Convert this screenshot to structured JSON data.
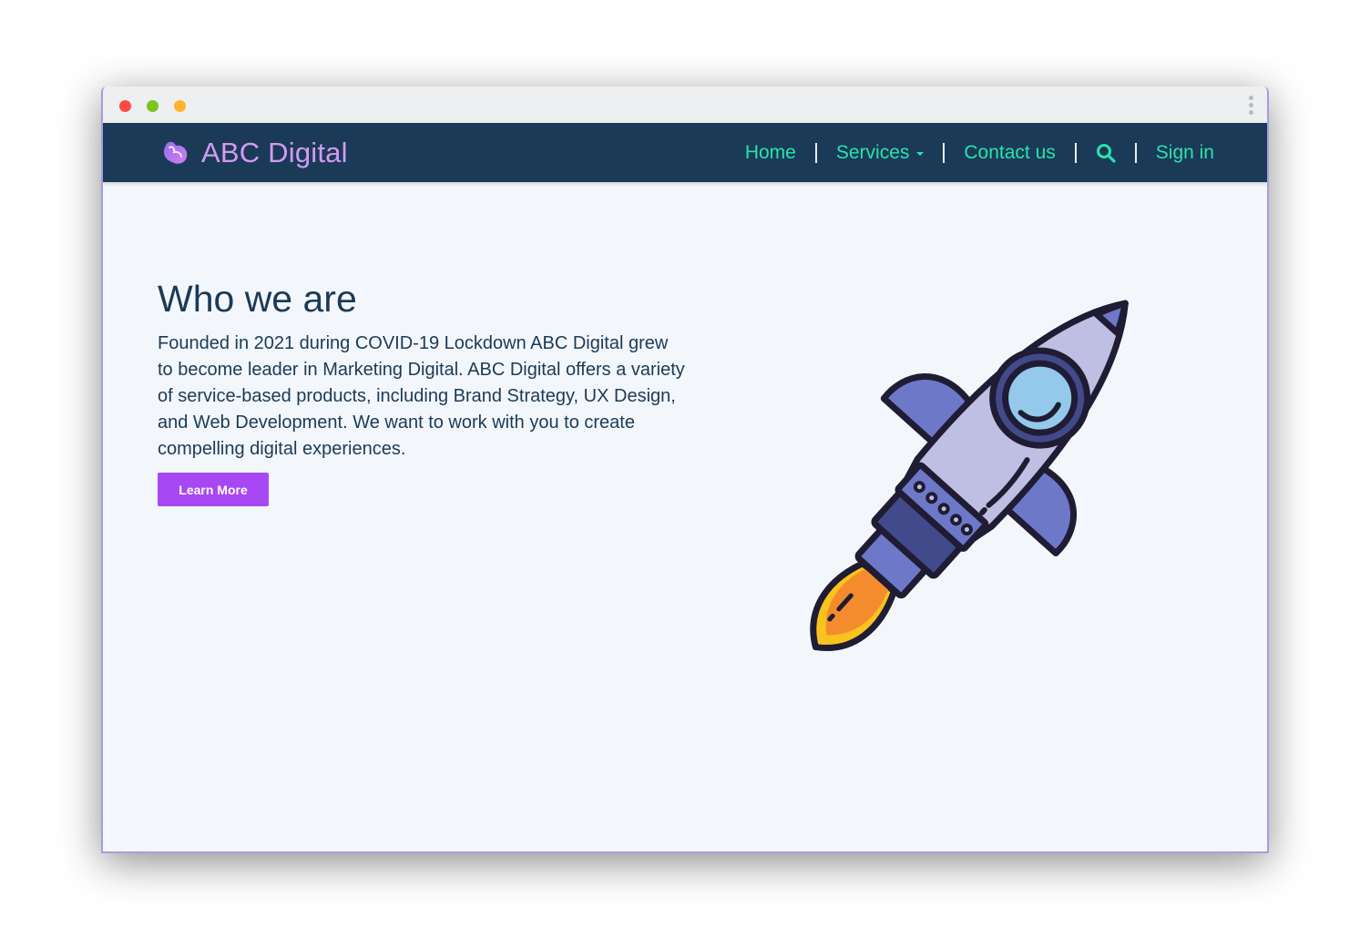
{
  "window": {
    "controls": [
      "close",
      "minimize",
      "maximize"
    ]
  },
  "navbar": {
    "brand_name": "ABC Digital",
    "brand_icon": "logo-icon",
    "links": {
      "home": "Home",
      "services": "Services",
      "contact": "Contact us",
      "signin": "Sign in"
    },
    "search_icon": "search-icon",
    "colors": {
      "background": "#1b3a58",
      "link": "#28e3ad",
      "brand": "#d39bf3"
    }
  },
  "hero": {
    "title": "Who we are",
    "body": "Founded in 2021 during COVID-19 Lockdown ABC Digital grew to become leader in Marketing Digital. ABC Digital offers a variety of service-based products, including Brand Strategy, UX Design, and Web Development. We want to work with you to create compelling digital experiences.",
    "button_label": "Learn More",
    "button_color": "#a847f4",
    "illustration": "rocket-illustration"
  }
}
